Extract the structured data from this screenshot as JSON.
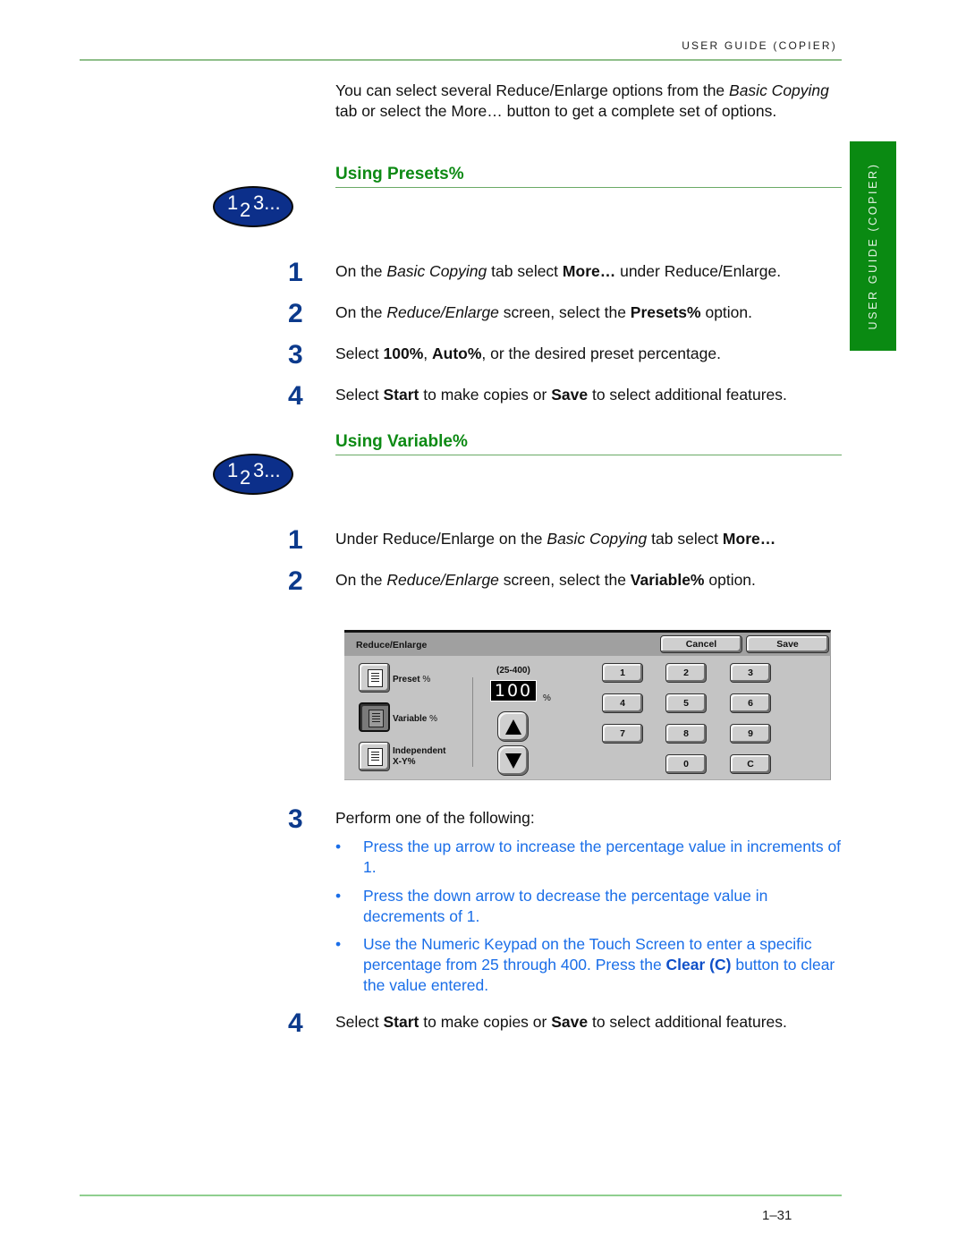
{
  "header": {
    "running_title": "USER GUIDE (COPIER)",
    "side_tab": "USER GUIDE (COPIER)"
  },
  "intro": {
    "part1": "You can select several Reduce/Enlarge options from the ",
    "italic1": "Basic Copying",
    "part2": " tab or select the More… button to get a complete set of options."
  },
  "badge_icon": "numbered-steps-icon",
  "sections": [
    {
      "title": "Using Presets%",
      "steps": [
        {
          "num": "1",
          "a": "On the ",
          "i": "Basic Copying",
          "b": " tab select ",
          "bold": "More…",
          "c": " under Reduce/Enlarge."
        },
        {
          "num": "2",
          "a": "On the ",
          "i": "Reduce/Enlarge",
          "b": " screen, select the ",
          "bold": "Presets%",
          "c": " option."
        },
        {
          "num": "3",
          "a": "Select ",
          "bold1": "100%",
          "b": ", ",
          "bold2": "Auto%",
          "c": ", or the desired preset percentage."
        },
        {
          "num": "4",
          "a": "Select ",
          "bold1": "Start",
          "b": " to make copies or ",
          "bold2": "Save",
          "c": " to select additional features."
        }
      ]
    },
    {
      "title": "Using Variable%",
      "steps": [
        {
          "num": "1",
          "a": "Under Reduce/Enlarge on the ",
          "i": "Basic Copying",
          "b": " tab select ",
          "bold": "More…"
        },
        {
          "num": "2",
          "a": "On the ",
          "i": "Reduce/Enlarge",
          "b": " screen, select the ",
          "bold": "Variable%",
          "c": " option."
        },
        {
          "num": "3",
          "a": "Perform one of the following:"
        },
        {
          "num": "4",
          "a": "Select ",
          "bold1": "Start",
          "b": " to make copies or ",
          "bold2": "Save",
          "c": " to select additional features."
        }
      ],
      "bullets": [
        {
          "text": "Press the up arrow to increase the percentage value in increments of 1."
        },
        {
          "text": "Press the down arrow to decrease the percentage value in decrements of 1."
        },
        {
          "a": "Use the Numeric Keypad on the Touch Screen to enter a specific percentage from 25 through 400.  Press the ",
          "bold": "Clear (C)",
          "b": " button to clear the value entered."
        }
      ]
    }
  ],
  "screen": {
    "title": "Reduce/Enlarge",
    "cancel": "Cancel",
    "save": "Save",
    "options": [
      {
        "label": "Preset",
        "pct": "%",
        "selected": false
      },
      {
        "label": "Variable",
        "pct": "%",
        "selected": true
      },
      {
        "label": "Independent",
        "label2": "X-Y%",
        "selected": false
      }
    ],
    "range": "(25-400)",
    "value": "100",
    "unit": "%",
    "keys": [
      "1",
      "2",
      "3",
      "4",
      "5",
      "6",
      "7",
      "8",
      "9",
      "0",
      "C"
    ]
  },
  "footer": {
    "page_number": "1–31"
  },
  "colors": {
    "heading_green": "#0d8a14",
    "step_blue": "#0c3a8c",
    "bullet_blue": "#1a6ee8",
    "side_tab_green": "#0a8a12"
  }
}
